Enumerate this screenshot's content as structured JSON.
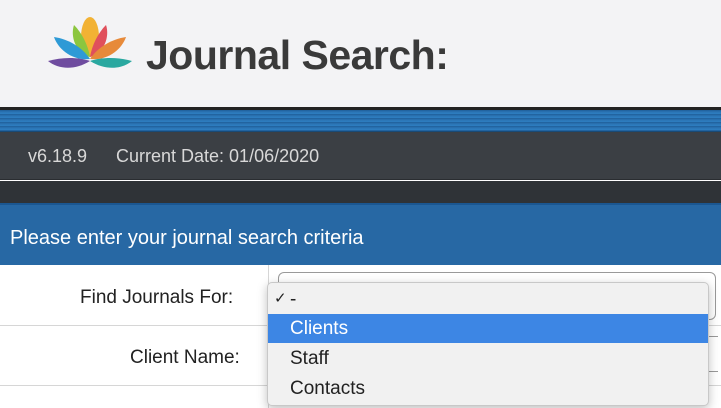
{
  "header": {
    "title": "Journal Search:",
    "logo_icon": "lotus-icon",
    "logo_colors": [
      "#f2b234",
      "#8cc63f",
      "#2e9ad6",
      "#6f4c9f",
      "#e0505c"
    ]
  },
  "status": {
    "version": "v6.18.9",
    "current_date": "Current Date: 01/06/2020"
  },
  "panel": {
    "title": "Please enter your journal search criteria"
  },
  "form": {
    "find_journals_label": "Find Journals For:",
    "client_name_label": "Client Name:"
  },
  "dropdown": {
    "checkmark": "✓",
    "options": [
      {
        "label": "-",
        "checked": true
      },
      {
        "label": "Clients",
        "highlighted": true
      },
      {
        "label": "Staff"
      },
      {
        "label": "Contacts"
      }
    ]
  },
  "colors": {
    "accent_blue": "#2768a4",
    "highlight": "#3d86e4",
    "status_bg": "#3b3f44"
  }
}
